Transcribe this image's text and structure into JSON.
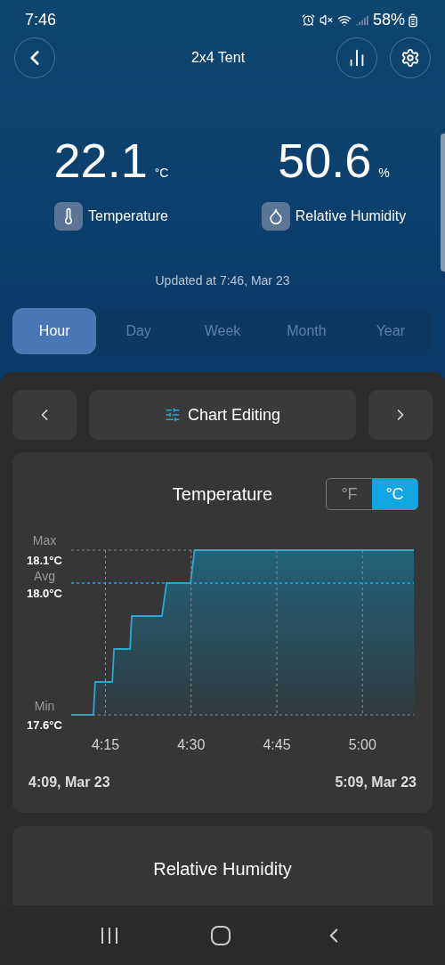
{
  "status_bar": {
    "time": "7:46",
    "battery": "58%"
  },
  "header": {
    "title": "2x4 Tent"
  },
  "readings": [
    {
      "kind": "temperature",
      "value": "22.1",
      "unit": "°C",
      "label": "Temperature"
    },
    {
      "kind": "humidity",
      "value": "50.6",
      "unit": "%",
      "label": "Relative Humidity"
    }
  ],
  "updated": "Updated at 7:46, Mar 23",
  "period_tabs": [
    {
      "label": "Hour",
      "selected": true
    },
    {
      "label": "Day",
      "selected": false
    },
    {
      "label": "Week",
      "selected": false
    },
    {
      "label": "Month",
      "selected": false
    },
    {
      "label": "Year",
      "selected": false
    }
  ],
  "chart_editing": {
    "label": "Chart Editing"
  },
  "temperature_card": {
    "title": "Temperature",
    "units": [
      {
        "label": "°F",
        "selected": false
      },
      {
        "label": "°C",
        "selected": true
      }
    ],
    "y_markers": [
      {
        "label": "Max"
      },
      {
        "label": "Avg"
      },
      {
        "label": "Min"
      }
    ],
    "chart_data": {
      "type": "area",
      "grid": true,
      "ref_lines": [
        {
          "axis": "y",
          "value": 18.0,
          "color": "#29a8d8"
        }
      ],
      "x": [
        4.15,
        4.215,
        4.22,
        4.27,
        4.275,
        4.3217,
        4.3267,
        4.415,
        4.4283,
        4.4983,
        4.51,
        5.15
      ],
      "series": [
        {
          "color": "#29a8d8",
          "values": [
            17.6,
            17.6,
            17.7,
            17.7,
            17.8,
            17.8,
            17.9,
            17.9,
            18.0,
            18.0,
            18.1,
            18.1
          ]
        }
      ],
      "xlim": [
        4.15,
        5.15
      ],
      "ylim": [
        17.6,
        18.1
      ],
      "xticks": [
        {
          "value": 4.25,
          "label": "4:15"
        },
        {
          "value": 4.5,
          "label": "4:30"
        },
        {
          "value": 4.75,
          "label": "4:45"
        },
        {
          "value": 5.0,
          "label": "5:00"
        }
      ],
      "yticks": [
        {
          "value": 18.1,
          "label": "18.1°C"
        },
        {
          "value": 18.0,
          "label": "18.0°C"
        },
        {
          "value": 17.6,
          "label": "17.6°C"
        }
      ]
    },
    "start": "4:09, Mar 23",
    "end": "5:09, Mar 23"
  },
  "humidity_card": {
    "title": "Relative Humidity"
  }
}
